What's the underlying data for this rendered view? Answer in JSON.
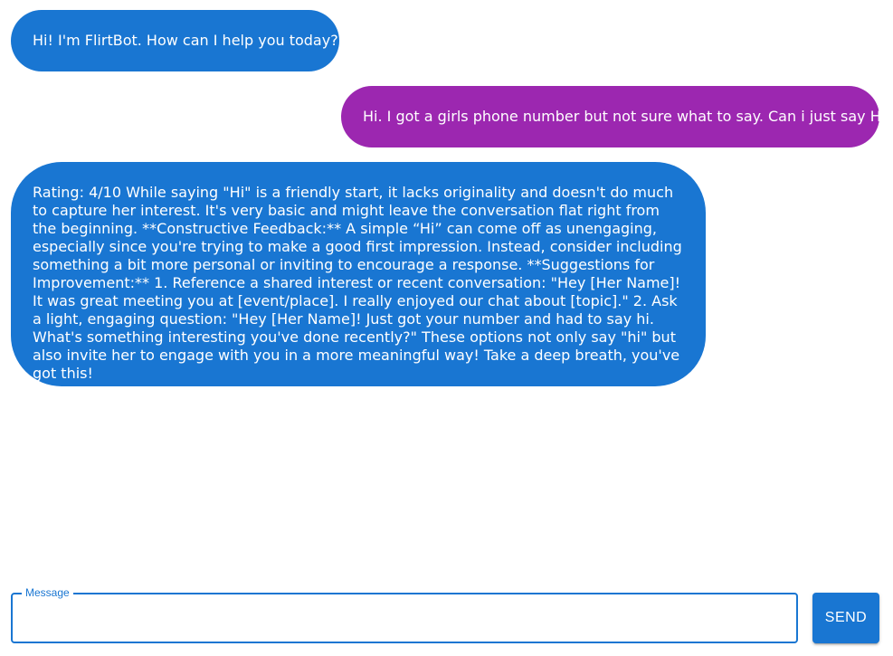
{
  "chat": {
    "messages": [
      {
        "sender": "bot",
        "text": "Hi! I'm FlirtBot. How can I help you today?"
      },
      {
        "sender": "user",
        "text": "Hi. I got a girls phone number but not sure what to say. Can i just say Hi?"
      },
      {
        "sender": "bot",
        "text": "Rating: 4/10 While saying \"Hi\" is a friendly start, it lacks originality and doesn't do much to capture her interest. It's very basic and might leave the conversation flat right from the beginning. **Constructive Feedback:** A simple “Hi” can come off as unengaging, especially since you're trying to make a good first impression. Instead, consider including something a bit more personal or inviting to encourage a response. **Suggestions for Improvement:** 1. Reference a shared interest or recent conversation: \"Hey [Her Name]! It was great meeting you at [event/place]. I really enjoyed our chat about [topic].\" 2. Ask a light, engaging question: \"Hey [Her Name]! Just got your number and had to say hi. What's something interesting you've done recently?\" These options not only say \"hi\" but also invite her to engage with you in a more meaningful way! Take a deep breath, you've got this!"
      }
    ]
  },
  "composer": {
    "label": "Message",
    "value": "",
    "placeholder": "",
    "send_label": "SEND"
  },
  "colors": {
    "bot_bubble": "#1976d2",
    "user_bubble": "#9c27b0",
    "accent": "#1976d2"
  }
}
